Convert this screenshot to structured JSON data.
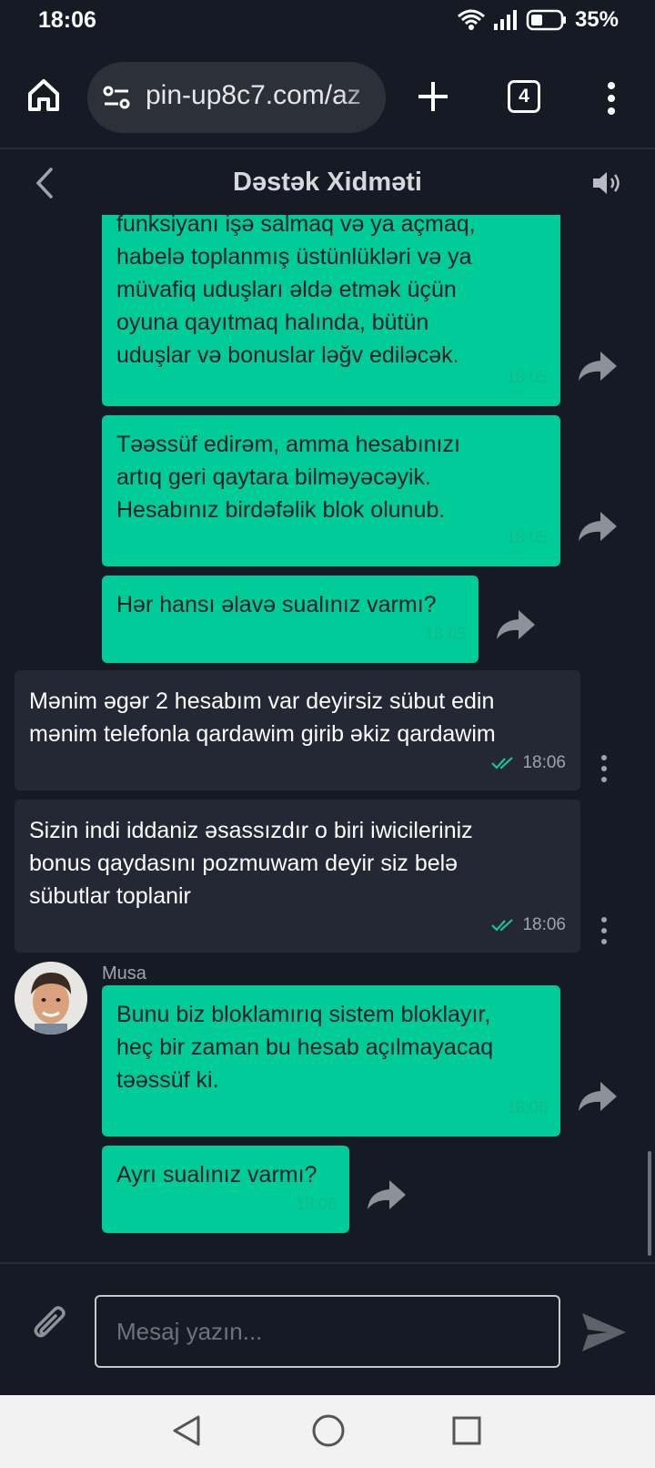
{
  "status_bar": {
    "time": "18:06",
    "battery": "35%"
  },
  "browser": {
    "url": "pin-up8c7.com/az",
    "tab_count": "4"
  },
  "chat": {
    "title": "Dəstək Xidməti"
  },
  "messages": [
    {
      "type": "operator",
      "lines": [
        "funksiyanı işə salmaq və ya açmaq,",
        "habelə toplanmış üstünlükləri və ya",
        "müvafiq uduşları əldə etmək üçün",
        "oyuna qayıtmaq halında, bütün",
        "uduşlar və bonuslar ləğv ediləcək."
      ],
      "time": "18:05"
    },
    {
      "type": "operator",
      "lines": [
        "Təəssüf edirəm, amma hesabınızı",
        "artıq geri qaytara bilməyəcəyik.",
        "Hesabınız birdəfəlik blok olunub."
      ],
      "time": "18:05"
    },
    {
      "type": "operator",
      "lines": [
        "Hər hansı əlavə sualınız varmı?"
      ],
      "time": "18:05"
    },
    {
      "type": "user",
      "lines": [
        "Mənim əgər 2 hesabım var deyirsiz sübut edin",
        "mənim telefonla qardawim girib əkiz qardawim"
      ],
      "time": "18:06"
    },
    {
      "type": "user",
      "lines": [
        "Sizin indi iddaniz əsassızdır o biri iwicileriniz",
        "bonus qaydasını pozmuwam deyir siz belə",
        "sübutlar toplanir"
      ],
      "time": "18:06"
    },
    {
      "type": "operator",
      "author": "Musa",
      "lines": [
        "Bunu biz bloklamırıq sistem bloklayır,",
        "heç bir zaman bu hesab açılmayacaq",
        "təəssüf ki."
      ],
      "time": "18:06"
    },
    {
      "type": "operator",
      "lines": [
        "Ayrı sualınız varmı?"
      ],
      "time": "18:06"
    }
  ],
  "composer": {
    "placeholder": "Mesaj yazın..."
  },
  "icons": {
    "home": "home-icon",
    "site_settings": "site-settings-icon",
    "new_tab": "plus-icon",
    "tabs": "tabs-icon",
    "menu": "more-vert-icon",
    "back": "chevron-left-icon",
    "sound": "speaker-icon",
    "share": "share-arrow-icon",
    "read": "double-check-icon",
    "attach": "paperclip-icon",
    "send": "send-icon"
  },
  "colors": {
    "background": "#161a24",
    "operator_bubble": "#00cc9a",
    "user_bubble": "#242834",
    "read_check": "#19c397"
  }
}
